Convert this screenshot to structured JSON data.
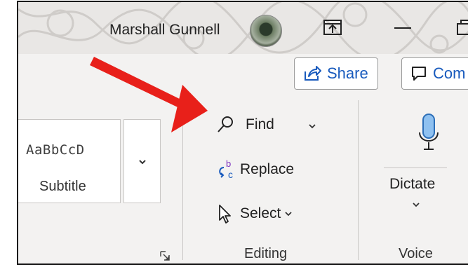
{
  "titlebar": {
    "user_name": "Marshall Gunnell"
  },
  "commands": {
    "share_label": "Share",
    "comments_label": "Com"
  },
  "styles": {
    "sample_text": "AaBbCcD",
    "style_name": "Subtitle"
  },
  "editing": {
    "find_label": "Find",
    "replace_label": "Replace",
    "select_label": "Select",
    "group_label": "Editing"
  },
  "voice": {
    "dictate_label": "Dictate",
    "group_label": "Voice"
  },
  "colors": {
    "accent": "#185abd",
    "annotation_arrow": "#e8201a",
    "mic_fill": "#8fc1f0"
  },
  "icons": [
    "ribbon-display-options-icon",
    "minimize-icon",
    "restore-icon",
    "share-icon",
    "comment-icon",
    "find-icon",
    "replace-icon",
    "select-cursor-icon",
    "microphone-icon",
    "dialog-launcher-icon",
    "chevron-down-icon"
  ]
}
